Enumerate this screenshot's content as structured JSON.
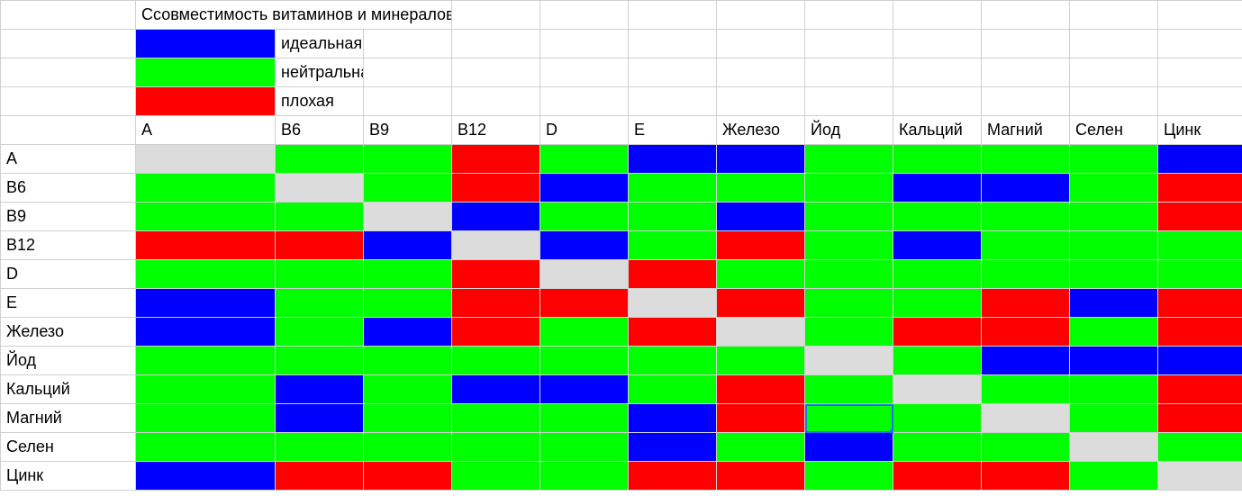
{
  "title": "Ссовместимость витаминов и минералов",
  "legend": {
    "ideal": {
      "label": "идеальная",
      "color": "#0000ff"
    },
    "neutral": {
      "label": "нейтральная",
      "color": "#00ff00"
    },
    "bad": {
      "label": "плохая",
      "color": "#ff0000"
    }
  },
  "chart_data": {
    "type": "heatmap",
    "title": "Ссовместимость витаминов и минералов",
    "xlabel": "",
    "ylabel": "",
    "categories": [
      "A",
      "B6",
      "B9",
      "B12",
      "D",
      "E",
      "Железо",
      "Йод",
      "Кальций",
      "Магний",
      "Селен",
      "Цинк"
    ],
    "row_labels": [
      "A",
      "B6",
      "B9",
      "B12",
      "D",
      "E",
      "Железо",
      "Йод",
      "Кальций",
      "Магний",
      "Селен",
      "Цинк"
    ],
    "value_codes": {
      "self": "diagonal / same item",
      "ideal": "идеальная",
      "neutral": "нейтральная",
      "bad": "плохая"
    },
    "matrix": [
      [
        "self",
        "neutral",
        "neutral",
        "bad",
        "neutral",
        "ideal",
        "ideal",
        "neutral",
        "neutral",
        "neutral",
        "neutral",
        "ideal"
      ],
      [
        "neutral",
        "self",
        "neutral",
        "bad",
        "ideal",
        "neutral",
        "neutral",
        "neutral",
        "ideal",
        "ideal",
        "neutral",
        "bad"
      ],
      [
        "neutral",
        "neutral",
        "self",
        "ideal",
        "neutral",
        "neutral",
        "ideal",
        "neutral",
        "neutral",
        "neutral",
        "neutral",
        "bad"
      ],
      [
        "bad",
        "bad",
        "ideal",
        "self",
        "ideal",
        "neutral",
        "bad",
        "neutral",
        "ideal",
        "neutral",
        "neutral",
        "neutral"
      ],
      [
        "neutral",
        "neutral",
        "neutral",
        "bad",
        "self",
        "bad",
        "neutral",
        "neutral",
        "neutral",
        "neutral",
        "neutral",
        "neutral"
      ],
      [
        "ideal",
        "neutral",
        "neutral",
        "bad",
        "bad",
        "self",
        "bad",
        "neutral",
        "neutral",
        "bad",
        "ideal",
        "bad"
      ],
      [
        "ideal",
        "neutral",
        "ideal",
        "bad",
        "neutral",
        "bad",
        "self",
        "neutral",
        "bad",
        "bad",
        "neutral",
        "bad"
      ],
      [
        "neutral",
        "neutral",
        "neutral",
        "neutral",
        "neutral",
        "neutral",
        "neutral",
        "self",
        "neutral",
        "ideal",
        "ideal",
        "ideal"
      ],
      [
        "neutral",
        "ideal",
        "neutral",
        "ideal",
        "ideal",
        "neutral",
        "bad",
        "neutral",
        "self",
        "neutral",
        "neutral",
        "bad"
      ],
      [
        "neutral",
        "ideal",
        "neutral",
        "neutral",
        "neutral",
        "ideal",
        "bad",
        "neutral",
        "neutral",
        "self",
        "neutral",
        "bad"
      ],
      [
        "neutral",
        "neutral",
        "neutral",
        "neutral",
        "neutral",
        "ideal",
        "neutral",
        "ideal",
        "neutral",
        "neutral",
        "self",
        "neutral"
      ],
      [
        "ideal",
        "bad",
        "bad",
        "neutral",
        "neutral",
        "bad",
        "bad",
        "neutral",
        "bad",
        "bad",
        "neutral",
        "self"
      ]
    ],
    "selected_cell": {
      "row": 9,
      "col": 7
    }
  }
}
